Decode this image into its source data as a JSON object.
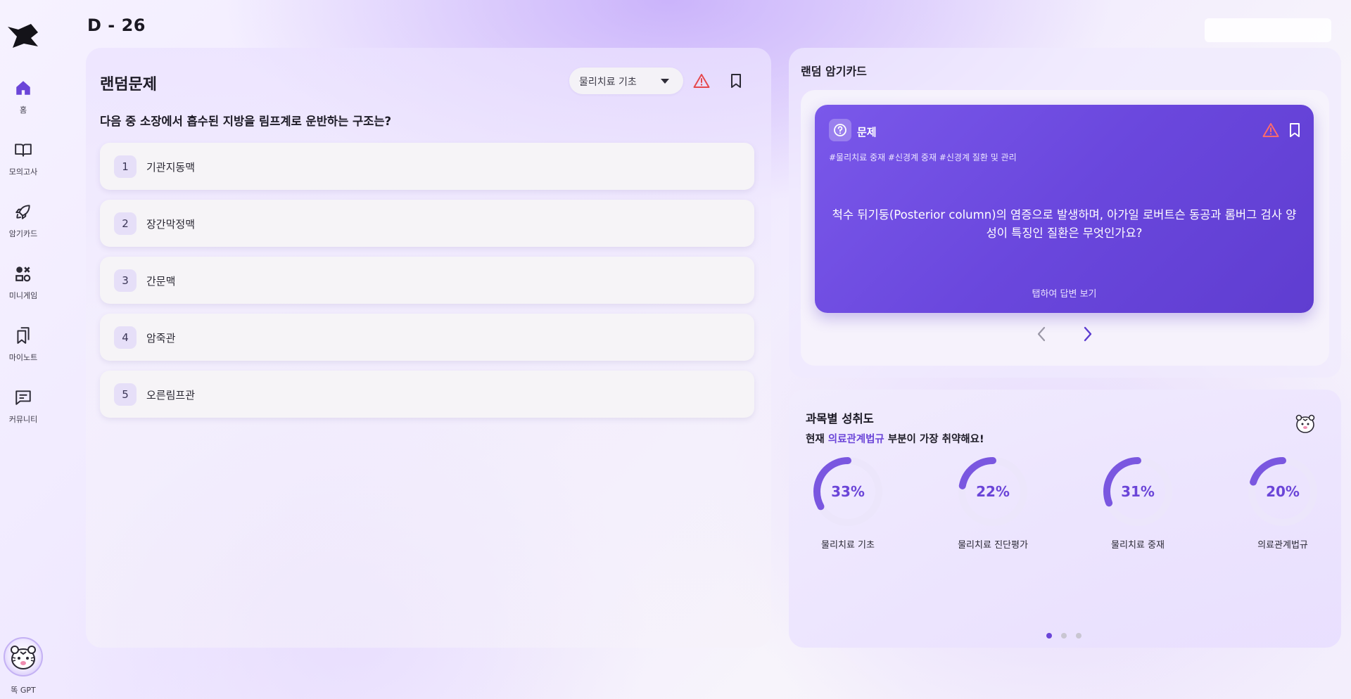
{
  "sidebar": {
    "items": [
      {
        "label": "홈",
        "icon": "home-icon",
        "active": true
      },
      {
        "label": "모의고사",
        "icon": "book-icon"
      },
      {
        "label": "암기카드",
        "icon": "rocket-icon"
      },
      {
        "label": "미니게임",
        "icon": "game-icon"
      },
      {
        "label": "마이노트",
        "icon": "bookmark-icon"
      },
      {
        "label": "커뮤니티",
        "icon": "chat-icon"
      }
    ],
    "gpt_label": "똑 GPT"
  },
  "header": {
    "dday": "D - 26"
  },
  "random_problem": {
    "title": "랜덤문제",
    "subject_select": "물리치료 기초",
    "question": "다음 중 소장에서 흡수된 지방을 림프계로 운반하는 구조는?",
    "options": [
      {
        "num": "1",
        "text": "기관지동맥"
      },
      {
        "num": "2",
        "text": "장간막정맥"
      },
      {
        "num": "3",
        "text": "간문맥"
      },
      {
        "num": "4",
        "text": "암죽관"
      },
      {
        "num": "5",
        "text": "오른림프관"
      }
    ]
  },
  "flashcard": {
    "title": "랜덤 암기카드",
    "card_label": "문제",
    "tags": "#물리치료 중재 #신경계 중재 #신경계 질환 및 관리",
    "question_line1": "척수 뒤기둥(Posterior column)의 염증으로 발생하며, 아가일 로버트슨 동공과 롬버그 검사 양",
    "question_line2": "성이 특징인 질환은 무엇인가요?",
    "hint": "탭하여 답변 보기"
  },
  "achievement": {
    "title": "과목별 성취도",
    "sub_prefix": "현재 ",
    "sub_highlight": "의료관계법규",
    "sub_suffix": " 부분이 가장 취약해요!",
    "subjects": [
      {
        "name": "물리치료 기초",
        "percent": 33,
        "label": "33%"
      },
      {
        "name": "물리치료 진단평가",
        "percent": 22,
        "label": "22%"
      },
      {
        "name": "물리치료 중재",
        "percent": 31,
        "label": "31%"
      },
      {
        "name": "의료관계법규",
        "percent": 20,
        "label": "20%"
      }
    ],
    "page_dots": 3,
    "active_dot": 0
  },
  "colors": {
    "accent": "#6b45d8",
    "card": "#6a47dd",
    "warning": "#e5484d"
  }
}
